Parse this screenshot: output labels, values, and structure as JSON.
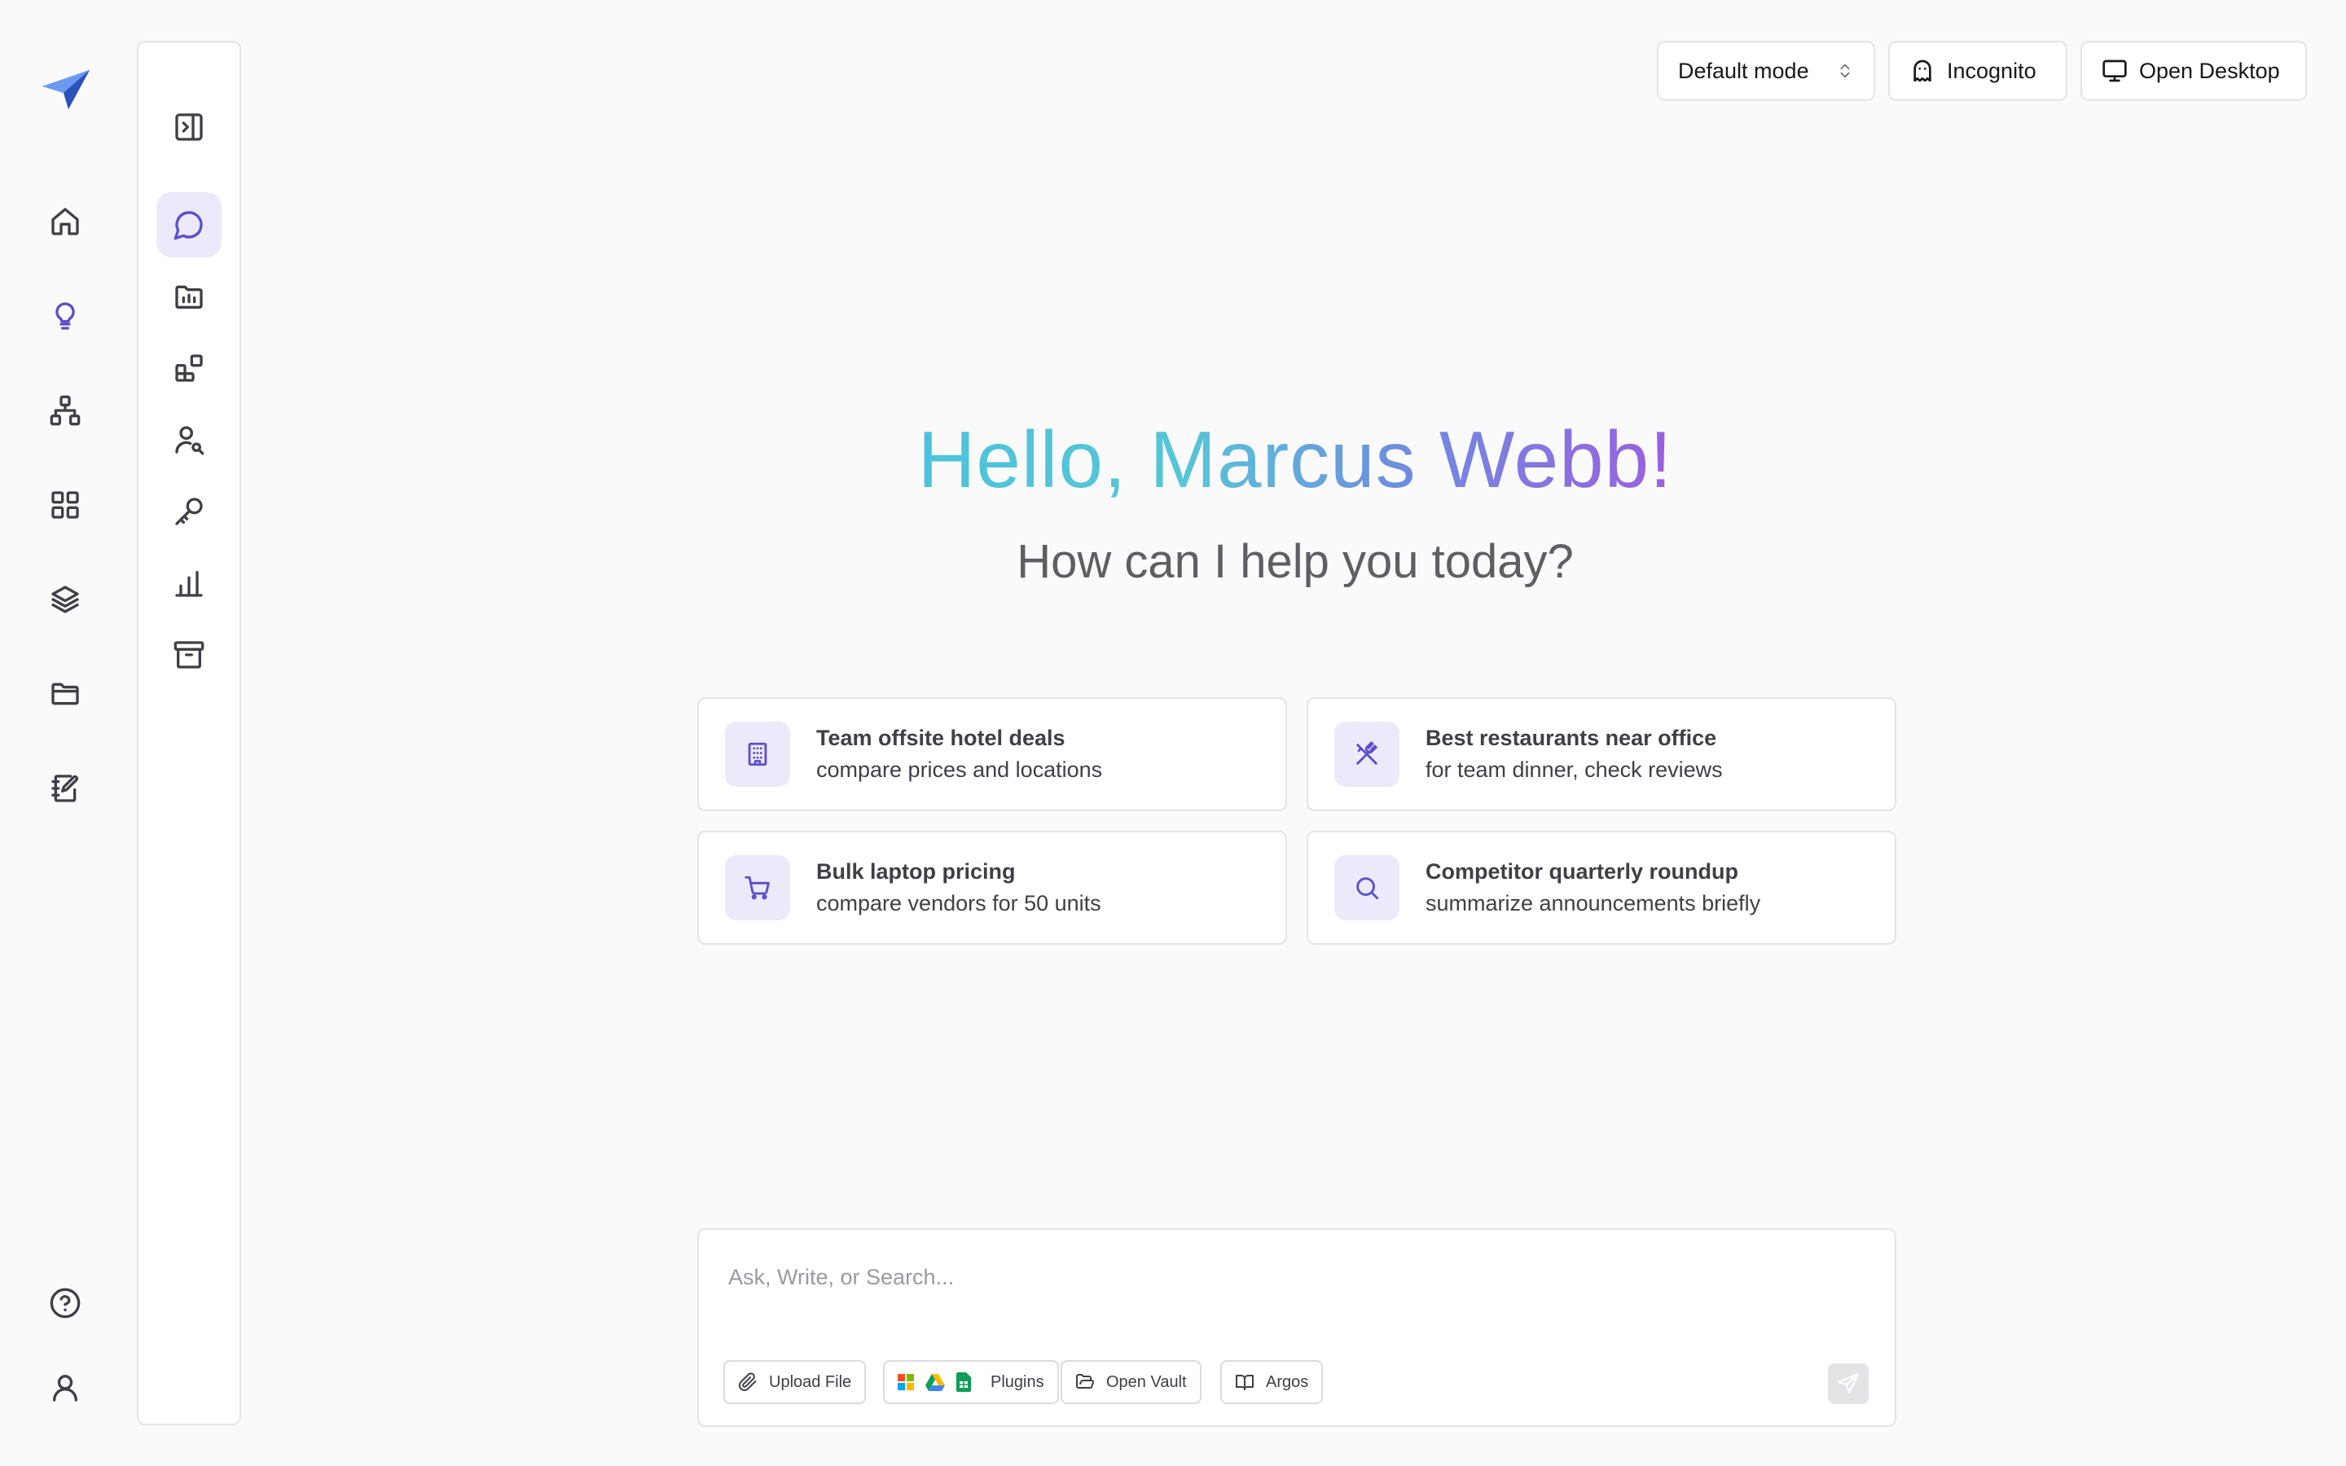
{
  "rail": {
    "logo": "paper-plane-logo",
    "items": [
      {
        "name": "home",
        "icon": "home-icon"
      },
      {
        "name": "ideas",
        "icon": "lightbulb-icon"
      },
      {
        "name": "workflows",
        "icon": "hierarchy-icon"
      },
      {
        "name": "apps",
        "icon": "grid-icon"
      },
      {
        "name": "layers",
        "icon": "layers-icon"
      },
      {
        "name": "files",
        "icon": "folder-icon"
      },
      {
        "name": "notes",
        "icon": "notebook-edit-icon"
      }
    ],
    "bottom": [
      {
        "name": "help",
        "icon": "help-circle-icon"
      },
      {
        "name": "profile",
        "icon": "user-icon"
      }
    ]
  },
  "panel": {
    "toggle_icon": "panel-collapse-icon",
    "items": [
      {
        "name": "chat",
        "icon": "chat-bubble-icon",
        "active": true
      },
      {
        "name": "projects",
        "icon": "folder-chart-icon"
      },
      {
        "name": "widgets",
        "icon": "widgets-icon"
      },
      {
        "name": "people-search",
        "icon": "user-search-icon"
      },
      {
        "name": "keys",
        "icon": "key-icon"
      },
      {
        "name": "analytics",
        "icon": "bar-chart-icon"
      },
      {
        "name": "archive",
        "icon": "archive-icon"
      }
    ]
  },
  "top": {
    "mode_label": "Default mode",
    "incognito_label": "Incognito",
    "desktop_label": "Open Desktop"
  },
  "greeting": "Hello, Marcus Webb!",
  "subtitle": "How can I help you today?",
  "suggestions": [
    {
      "title": "Team offsite hotel deals",
      "subtitle": "compare prices and locations",
      "icon": "building-icon"
    },
    {
      "title": "Best restaurants near office",
      "subtitle": "for team dinner, check reviews",
      "icon": "utensils-icon"
    },
    {
      "title": "Bulk laptop pricing",
      "subtitle": "compare vendors for 50 units",
      "icon": "cart-icon"
    },
    {
      "title": "Competitor quarterly roundup",
      "subtitle": "summarize announcements briefly",
      "icon": "search-icon"
    }
  ],
  "composer": {
    "placeholder": "Ask, Write, or Search...",
    "value": "",
    "chips": {
      "upload": "Upload File",
      "plugins": "Plugins",
      "vault": "Open Vault",
      "argos": "Argos"
    }
  },
  "colors": {
    "accent": "#5b4fc9",
    "accent_bg": "#ece9fb",
    "gradient_start": "#4cc3dc",
    "gradient_end": "#9b5fe0"
  }
}
